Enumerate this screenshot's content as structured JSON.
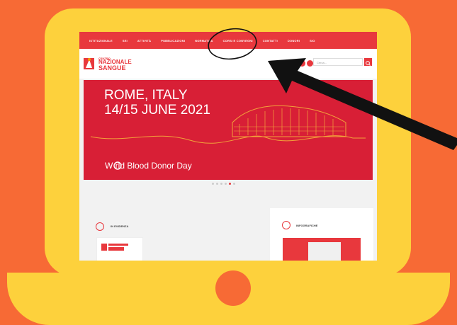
{
  "nav": {
    "items": [
      "ISTITUZIONALE",
      "SEI",
      "ATTIVITÀ",
      "PUBBLICAZIONI",
      "NORMATIVA",
      "CORSI E CONVEGNI",
      "CONTATTI",
      "DONORI",
      "SIO"
    ]
  },
  "header": {
    "logo_small": "CENTRO",
    "logo_line1": "NAZIONALE",
    "logo_line2": "SANGUE",
    "search_placeholder": "Cerca..."
  },
  "banner": {
    "city": "ROME, ITALY",
    "date": "14/15 JUNE 2021",
    "event": "W  rld Blood Donor Day"
  },
  "slider": {
    "total": 6,
    "active": 4
  },
  "panels": {
    "left_title": "IN EVIDENZA",
    "right_title": "INFOGRAFICHE"
  },
  "colors": {
    "background": "#f76a35",
    "laptop": "#fdd13c",
    "brand": "#e8383d",
    "banner": "#d81f36"
  }
}
